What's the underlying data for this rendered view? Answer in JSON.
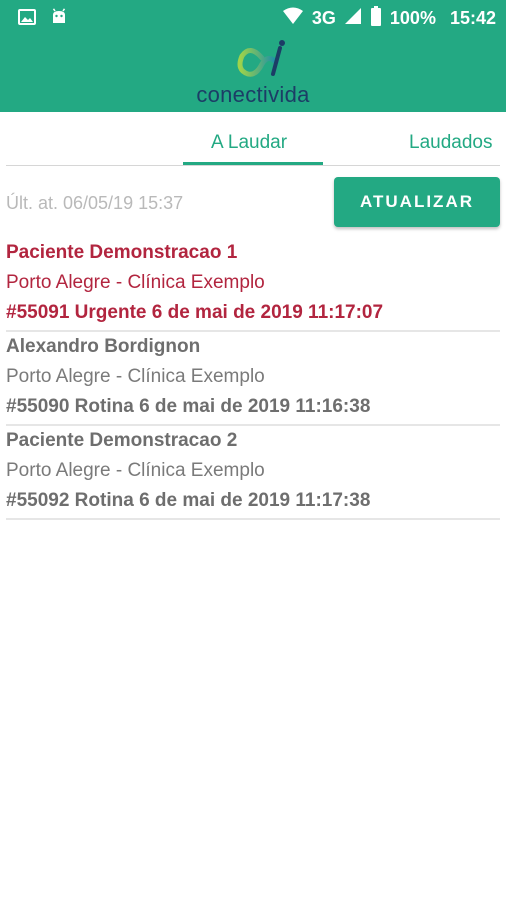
{
  "status_bar": {
    "network": "3G",
    "battery": "100%",
    "time": "15:42",
    "icons": [
      "image-icon",
      "android-icon",
      "wifi-icon",
      "signal-icon",
      "battery-icon"
    ]
  },
  "header": {
    "logo_text": "conectivida",
    "color": "#23a983"
  },
  "tabs": [
    {
      "label": "A Laudar",
      "active": true
    },
    {
      "label": "Laudados",
      "active": false
    }
  ],
  "toolbar": {
    "last_update": "Últ. at. 06/05/19 15:37",
    "refresh_label": "ATUALIZAR"
  },
  "exams": [
    {
      "patient": "Paciente Demonstracao 1",
      "location": "Porto Alegre - Clínica Exemplo",
      "meta": "#55091 Urgente 6 de mai de 2019 11:17:07",
      "priority": "urgent"
    },
    {
      "patient": "Alexandro Bordignon",
      "location": "Porto Alegre - Clínica Exemplo",
      "meta": "#55090 Rotina 6 de mai de 2019 11:16:38",
      "priority": "routine"
    },
    {
      "patient": "Paciente Demonstracao 2",
      "location": "Porto Alegre - Clínica Exemplo",
      "meta": "#55092 Rotina 6 de mai de 2019 11:17:38",
      "priority": "routine"
    }
  ],
  "colors": {
    "accent": "#23a983",
    "urgent": "#b2253f",
    "routine": "#6e6e6e"
  }
}
